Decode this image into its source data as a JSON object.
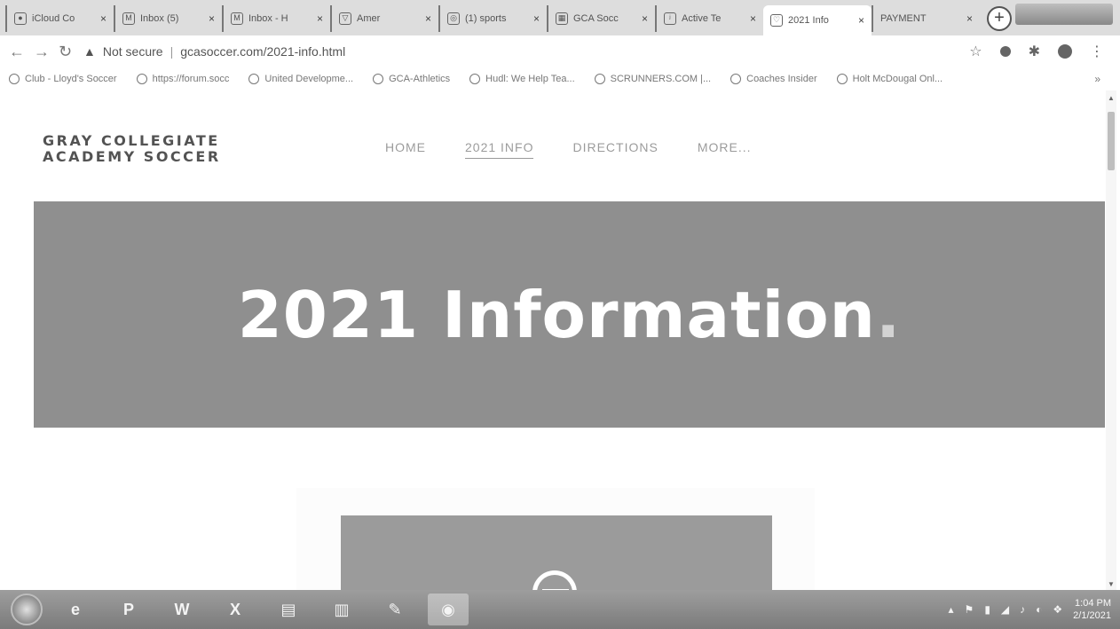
{
  "tabs": [
    {
      "title": "iCloud Co",
      "icon": "apple-icon"
    },
    {
      "title": "Inbox (5)",
      "icon": "gmail-icon"
    },
    {
      "title": "Inbox - H",
      "icon": "gmail-icon"
    },
    {
      "title": "Amer",
      "icon": "shield-icon"
    },
    {
      "title": "(1) sports",
      "icon": "messenger-icon"
    },
    {
      "title": "GCA Socc",
      "icon": "table-icon"
    },
    {
      "title": "Active Te",
      "icon": "activeteam-icon"
    },
    {
      "title": "2021 Info",
      "icon": "site-icon",
      "active": true
    },
    {
      "title": "PAYMENT",
      "icon": "blank-icon"
    }
  ],
  "browser": {
    "security": "Not secure",
    "url": "gcasoccer.com/2021-info.html"
  },
  "bookmarks": [
    "Club - Lloyd's Soccer",
    "https://forum.socc",
    "United Developme...",
    "GCA-Athletics",
    "Hudl: We Help Tea...",
    "SCRUNNERS.COM |...",
    "Coaches Insider",
    "Holt McDougal Onl..."
  ],
  "bookmarks_more": "»",
  "site": {
    "logo_line1": "GRAY COLLEGIATE",
    "logo_line2": "ACADEMY SOCCER",
    "nav": [
      "HOME",
      "2021 INFO",
      "DIRECTIONS",
      "MORE..."
    ],
    "hero_title": "2021 Information",
    "hero_period": "."
  },
  "taskbar": {
    "time": "1:04 PM",
    "date": "2/1/2021"
  }
}
